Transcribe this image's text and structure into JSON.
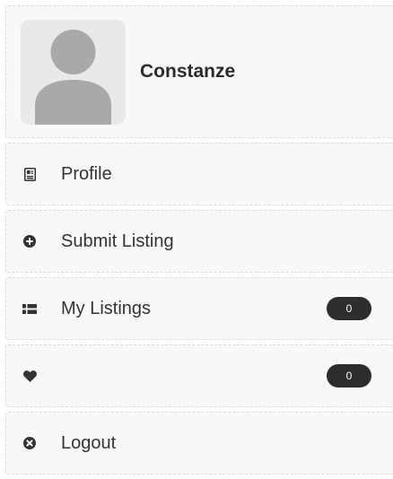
{
  "user": {
    "name": "Constanze",
    "avatar_icon": "default-user-avatar"
  },
  "menu": {
    "items": [
      {
        "label": "Profile",
        "icon": "id-card-icon"
      },
      {
        "label": "Submit Listing",
        "icon": "plus-circle-icon"
      },
      {
        "label": "My Listings",
        "icon": "grid-list-icon",
        "badge": "0"
      },
      {
        "label": "",
        "icon": "heart-icon",
        "badge": "0"
      },
      {
        "label": "Logout",
        "icon": "close-circle-icon"
      }
    ]
  },
  "colors": {
    "card_background": "#f8f8f8",
    "badge_background": "#2d2d2d",
    "avatar_fill": "#a9a9a9"
  }
}
